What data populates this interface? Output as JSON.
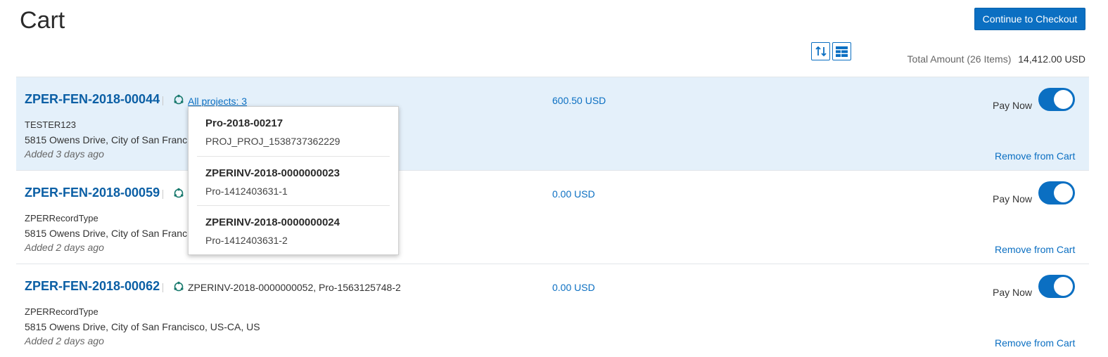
{
  "header": {
    "title": "Cart",
    "checkout_label": "Continue to Checkout",
    "total_label": "Total Amount (26 Items)",
    "total_value": "14,412.00 USD"
  },
  "toolbar": {
    "sort_icon": "sort-arrows-icon",
    "layout_icon": "table-view-icon"
  },
  "colors": {
    "accent": "#0b6fc2",
    "highlight_row": "#e4f0fa"
  },
  "rows": [
    {
      "id": "ZPER-FEN-2018-00044",
      "projects": "All projects: 3",
      "type": "TESTER123",
      "address": "5815 Owens Drive, City of San Francis",
      "added": "Added 3 days ago",
      "amount": "600.50 USD",
      "pay_label": "Pay Now",
      "pay_now": true,
      "remove_label": "Remove from Cart"
    },
    {
      "id": "ZPER-FEN-2018-00059",
      "type": "ZPERRecordType",
      "address": "5815 Owens Drive, City of San Francis",
      "added": "Added 2 days ago",
      "amount": "0.00 USD",
      "pay_label": "Pay Now",
      "pay_now": true,
      "remove_label": "Remove from Cart"
    },
    {
      "id": "ZPER-FEN-2018-00062",
      "projects": "ZPERINV-2018-0000000052, Pro-1563125748-2",
      "type": "ZPERRecordType",
      "address": "5815 Owens Drive, City of San Francisco, US-CA, US",
      "added": "Added 2 days ago",
      "amount": "0.00 USD",
      "pay_label": "Pay Now",
      "pay_now": true,
      "remove_label": "Remove from Cart"
    }
  ],
  "popup": {
    "items": [
      {
        "title": "Pro-2018-00217",
        "subtitle": "PROJ_PROJ_1538737362229"
      },
      {
        "title": "ZPERINV-2018-0000000023",
        "subtitle": "Pro-1412403631-1"
      },
      {
        "title": "ZPERINV-2018-0000000024",
        "subtitle": "Pro-1412403631-2"
      }
    ]
  }
}
